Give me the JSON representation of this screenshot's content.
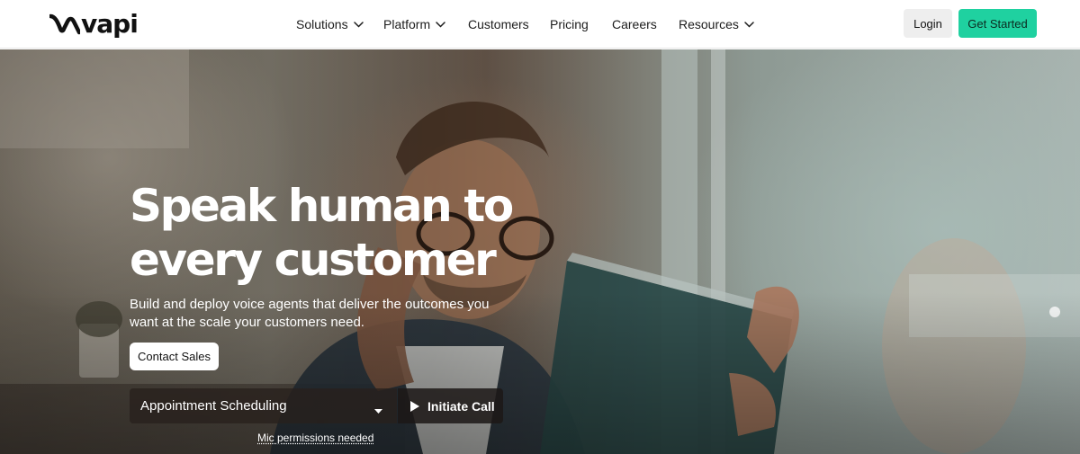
{
  "brand": {
    "name": "vapi",
    "accent_color": "#1fd1a0"
  },
  "nav": {
    "items": [
      {
        "label": "Solutions",
        "has_dropdown": true,
        "icon": "chevron-down-icon"
      },
      {
        "label": "Platform",
        "has_dropdown": true,
        "icon": "chevron-down-icon"
      },
      {
        "label": "Customers",
        "has_dropdown": false
      },
      {
        "label": "Pricing",
        "has_dropdown": false
      },
      {
        "label": "Careers",
        "has_dropdown": false
      },
      {
        "label": "Resources",
        "has_dropdown": true,
        "icon": "chevron-down-icon"
      }
    ]
  },
  "header_actions": {
    "login_label": "Login",
    "get_started_label": "Get Started"
  },
  "hero": {
    "headline": "Speak human to every customer",
    "subtitle": "Build and deploy voice agents that deliver the outcomes you want at the scale your customers need.",
    "contact_label": "Contact Sales",
    "demo": {
      "selected_option": "Appointment Scheduling",
      "call_label": "Initiate Call",
      "call_icon": "play-icon",
      "mic_note": "Mic permissions needed"
    }
  }
}
